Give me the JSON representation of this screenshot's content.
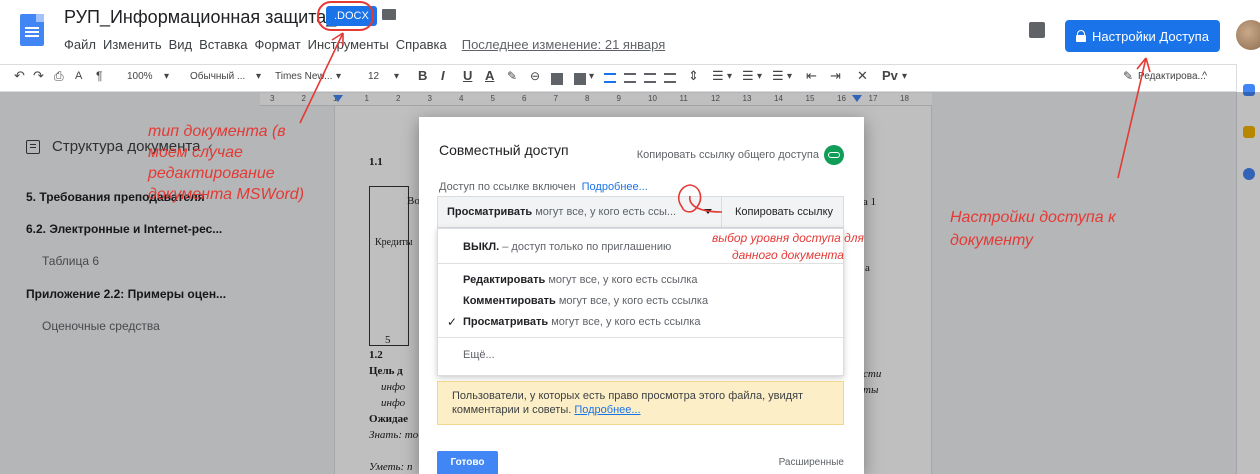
{
  "app": {
    "doc_title": "РУП_Информационная защита_2019",
    "format_badge": ".DOCX"
  },
  "menu": [
    "Файл",
    "Изменить",
    "Вид",
    "Вставка",
    "Формат",
    "Инструменты",
    "Справка"
  ],
  "last_edit": "Последнее изменение: 21 января",
  "share_button": "Настройки Доступа",
  "toolbar": {
    "zoom": "100%",
    "style": "Обычный ...",
    "font": "Times New...",
    "size": "12",
    "bold": "B",
    "italic": "I",
    "underline": "U",
    "text_color": "A",
    "pv": "Pv",
    "edit_mode": "Редактирова..."
  },
  "ruler": [
    "3",
    "2",
    "1",
    "1",
    "2",
    "3",
    "4",
    "5",
    "6",
    "7",
    "8",
    "9",
    "10",
    "11",
    "12",
    "13",
    "14",
    "15",
    "16",
    "17",
    "18"
  ],
  "outline": {
    "title": "Структура документа",
    "items": [
      {
        "label": "5. Требования преподавателя",
        "style": "bold"
      },
      {
        "label": "6.2. Электронные и Internet-рес...",
        "style": "bold"
      },
      {
        "label": "Таблица 6",
        "style": "sub"
      },
      {
        "label": "Приложение 2.2: Примеры оцен...",
        "style": "bold"
      },
      {
        "label": "Оценочные средства",
        "style": "sub"
      }
    ]
  },
  "document": {
    "h1": "1.1",
    "table_label": "Во",
    "credit": "Кредиты",
    "num5": "5",
    "h2": "1.2",
    "goal": "Цель   д",
    "line1": "инфо",
    "line2": "инфо",
    "expected": "Ожидае",
    "know": "Знать: то",
    "able": "Уметь: п",
    "right1": "а 1",
    "right2": "а",
    "right3": "сти",
    "right4": "ты"
  },
  "dialog": {
    "title": "Совместный доступ",
    "copy_public": "Копировать ссылку общего доступа",
    "status": "Доступ по ссылке включен",
    "more_link": "Подробнее...",
    "select_bold": "Просматривать",
    "select_rest": " могут все, у кого есть ссы...",
    "copy_link": "Копировать ссылку",
    "options": [
      {
        "bold": "ВЫКЛ.",
        "rest": " – доступ только по приглашению",
        "checked": false
      },
      {
        "bold": "Редактировать",
        "rest": " могут все, у кого есть ссылка",
        "checked": false
      },
      {
        "bold": "Комментировать",
        "rest": " могут все, у кого есть ссылка",
        "checked": false
      },
      {
        "bold": "Просматривать",
        "rest": " могут все, у кого есть ссылка",
        "checked": true
      }
    ],
    "more_options": "Ещё...",
    "check_mark": "✓",
    "info": "Пользователи, у которых есть право просмотра этого файла, увидят комментарии и советы.",
    "info_link": "Подробнее...",
    "done": "Готово",
    "advanced": "Расширенные"
  },
  "annotations": {
    "doc_type": [
      "тип документа (в",
      "моем случае",
      "редактирование",
      "документа MSWord)"
    ],
    "access_level": [
      "выбор уровня доступа для",
      "данного документа"
    ],
    "share_settings": [
      "Настройки доступа к",
      "документу"
    ]
  },
  "colors": {
    "accent": "#1a73e8",
    "annotation": "#e53935",
    "info_bg": "#fcefc7"
  }
}
